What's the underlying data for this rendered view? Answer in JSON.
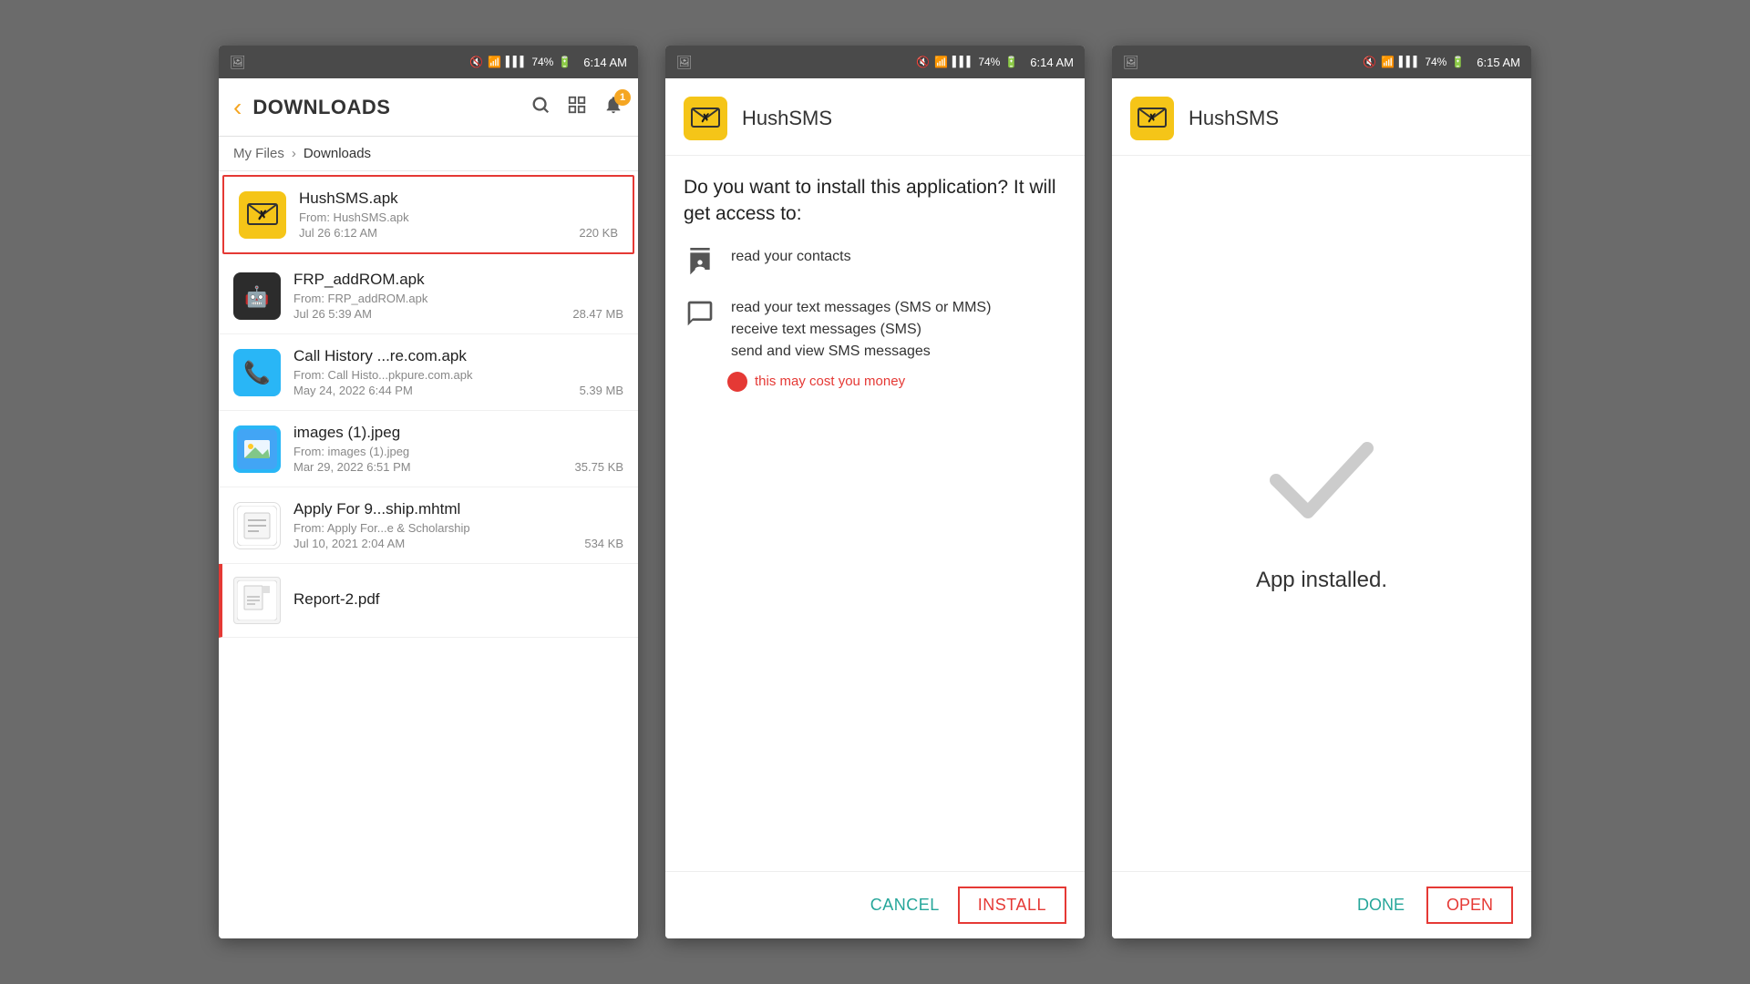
{
  "screen1": {
    "statusBar": {
      "time": "6:14 AM",
      "battery": "74%",
      "icons": "🔇 📶 🔋"
    },
    "toolbar": {
      "title": "DOWNLOADS",
      "backIcon": "‹",
      "searchIcon": "🔍",
      "gridIcon": "⊞",
      "notificationIcon": "🔔",
      "notificationCount": "1"
    },
    "breadcrumb": {
      "root": "My Files",
      "current": "Downloads"
    },
    "files": [
      {
        "name": "HushSMS.apk",
        "from": "From: HushSMS.apk",
        "date": "Jul 26 6:12 AM",
        "size": "220 KB",
        "selected": true,
        "iconType": "hushsms"
      },
      {
        "name": "FRP_addROM.apk",
        "from": "From: FRP_addROM.apk",
        "date": "Jul 26 5:39 AM",
        "size": "28.47 MB",
        "selected": false,
        "iconType": "frp"
      },
      {
        "name": "Call History ...re.com.apk",
        "from": "From: Call Histo...pkpure.com.apk",
        "date": "May 24, 2022 6:44 PM",
        "size": "5.39 MB",
        "selected": false,
        "iconType": "callhistory"
      },
      {
        "name": "images (1).jpeg",
        "from": "From: images (1).jpeg",
        "date": "Mar 29, 2022 6:51 PM",
        "size": "35.75 KB",
        "selected": false,
        "iconType": "images"
      },
      {
        "name": "Apply For 9...ship.mhtml",
        "from": "From: Apply For...e & Scholarship",
        "date": "Jul 10, 2021 2:04 AM",
        "size": "534 KB",
        "selected": false,
        "iconType": "apply"
      },
      {
        "name": "Report-2.pdf",
        "from": "",
        "date": "",
        "size": "",
        "selected": false,
        "iconType": "pdf"
      }
    ]
  },
  "screen2": {
    "statusBar": {
      "time": "6:14 AM",
      "battery": "74%"
    },
    "appName": "HushSMS",
    "question": "Do you want to install this application? It will get access to:",
    "permissions": [
      {
        "iconType": "contacts",
        "text": "read your contacts"
      },
      {
        "iconType": "sms",
        "textLines": [
          "read your text messages (SMS or MMS)",
          "receive text messages (SMS)",
          "send and view SMS messages"
        ],
        "warning": "this may cost you money"
      }
    ],
    "buttons": {
      "cancel": "CANCEL",
      "install": "INSTALL"
    }
  },
  "screen3": {
    "statusBar": {
      "time": "6:15 AM",
      "battery": "74%"
    },
    "appName": "HushSMS",
    "installedText": "App installed.",
    "checkmark": "✓",
    "buttons": {
      "done": "DONE",
      "open": "OPEN"
    }
  }
}
